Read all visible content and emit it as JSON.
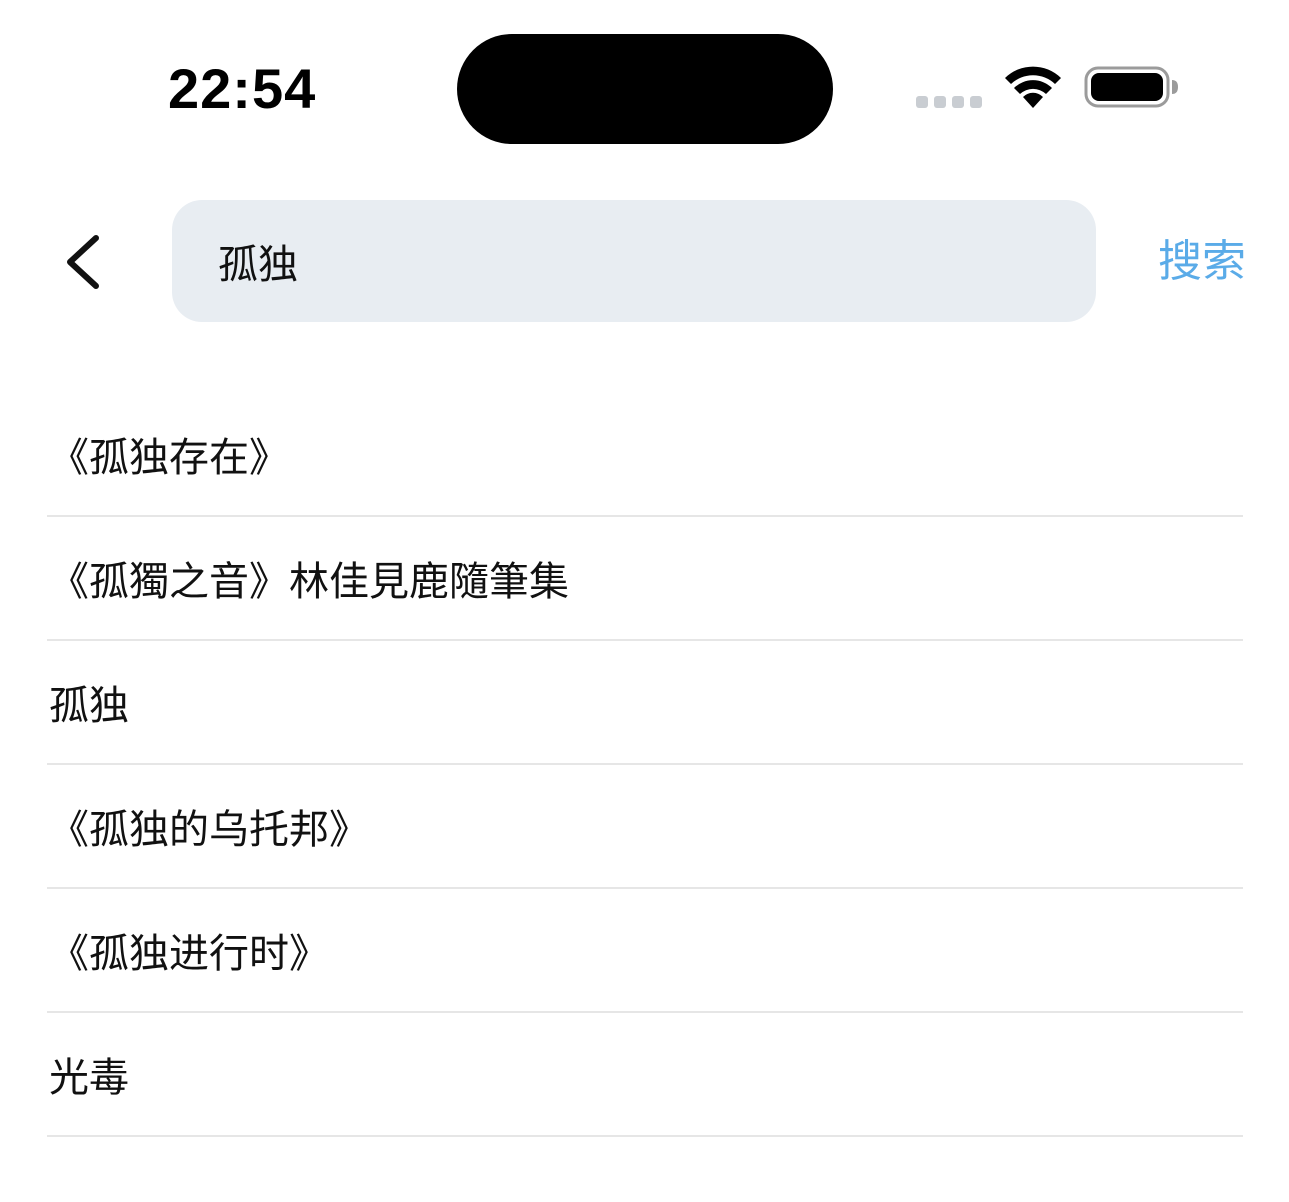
{
  "status_bar": {
    "time": "22:54"
  },
  "search": {
    "query": "孤独",
    "submit_label": "搜索"
  },
  "colors": {
    "accent": "#5aabe8",
    "search_box_bg": "#e8edf2",
    "divider": "#e6e6e6"
  },
  "suggestions": [
    {
      "label": "《孤独存在》"
    },
    {
      "label": "《孤獨之音》林佳見鹿隨筆集"
    },
    {
      "label": "孤独"
    },
    {
      "label": "《孤独的乌托邦》"
    },
    {
      "label": "《孤独进行时》"
    },
    {
      "label": "光毒"
    }
  ]
}
